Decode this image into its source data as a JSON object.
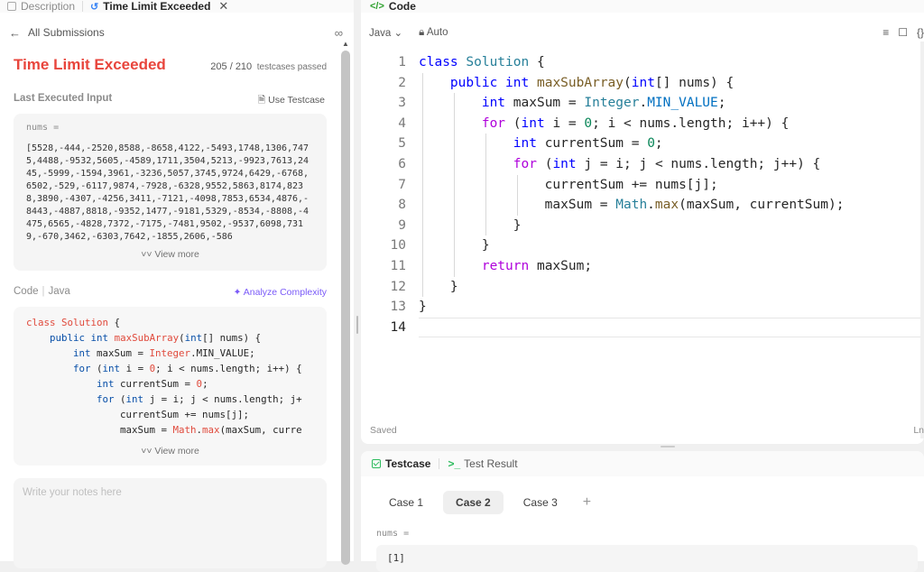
{
  "left_tabs": {
    "description": "Description",
    "result": "Time Limit Exceeded"
  },
  "submissions": {
    "back_label": "All Submissions"
  },
  "result": {
    "verdict": "Time Limit Exceeded",
    "passed": "205 / 210",
    "passed_suffix": "testcases passed",
    "last_input_title": "Last Executed Input",
    "use_testcase": "Use Testcase",
    "input_var": "nums =",
    "input_value": "[5528,-444,-2520,8588,-8658,4122,-5493,1748,1306,7475,4488,-9532,5605,-4589,1711,3504,5213,-9923,7613,2445,-5999,-1594,3961,-3236,5057,3745,9724,6429,-6768,6502,-529,-6117,9874,-7928,-6328,9552,5863,8174,8238,3890,-4307,-4256,3411,-7121,-4098,7853,6534,4876,-8443,-4887,8818,-9352,1477,-9181,5329,-8534,-8808,-4475,6565,-4828,7372,-7175,-7481,9502,-9537,6098,7319,-670,3462,-6303,7642,-1855,2606,-586",
    "view_more": "View more",
    "code_label": "Code",
    "code_lang": "Java",
    "analyze": "Analyze Complexity",
    "notes_placeholder": "Write your notes here"
  },
  "editor": {
    "tab_title": "Code",
    "language": "Java",
    "mode": "Auto",
    "saved": "Saved",
    "ln_info": "Ln",
    "line_numbers": [
      "1",
      "2",
      "3",
      "4",
      "5",
      "6",
      "7",
      "8",
      "9",
      "10",
      "11",
      "12",
      "13",
      "14"
    ]
  },
  "testpanel": {
    "tab_testcase": "Testcase",
    "tab_result": "Test Result",
    "cases": [
      "Case 1",
      "Case 2",
      "Case 3"
    ],
    "active_case": "Case 2",
    "var": "nums =",
    "value": "[1]"
  }
}
